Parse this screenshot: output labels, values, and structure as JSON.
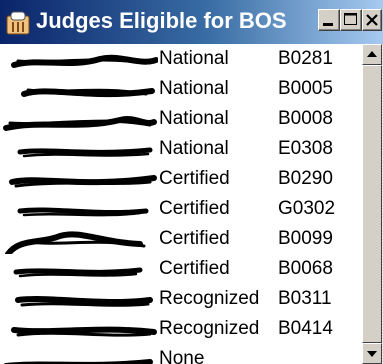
{
  "window": {
    "title": "Judges Eligible for BOS",
    "icon": "judge-app-icon",
    "caption_buttons": [
      "minimize-icon",
      "maximize-icon",
      "close-icon"
    ]
  },
  "rows": [
    {
      "level": "National",
      "id": "B0281"
    },
    {
      "level": "National",
      "id": "B0005"
    },
    {
      "level": "National",
      "id": "B0008"
    },
    {
      "level": "National",
      "id": "E0308"
    },
    {
      "level": "Certified",
      "id": "B0290"
    },
    {
      "level": "Certified",
      "id": "G0302"
    },
    {
      "level": "Certified",
      "id": "B0099"
    },
    {
      "level": "Certified",
      "id": "B0068"
    },
    {
      "level": "Recognized",
      "id": "B0311"
    },
    {
      "level": "Recognized",
      "id": "B0414"
    },
    {
      "level": "None",
      "id": ""
    }
  ],
  "scrollbar": {
    "up_icon": "scroll-up-arrow-icon",
    "down_icon": "scroll-down-arrow-icon"
  }
}
